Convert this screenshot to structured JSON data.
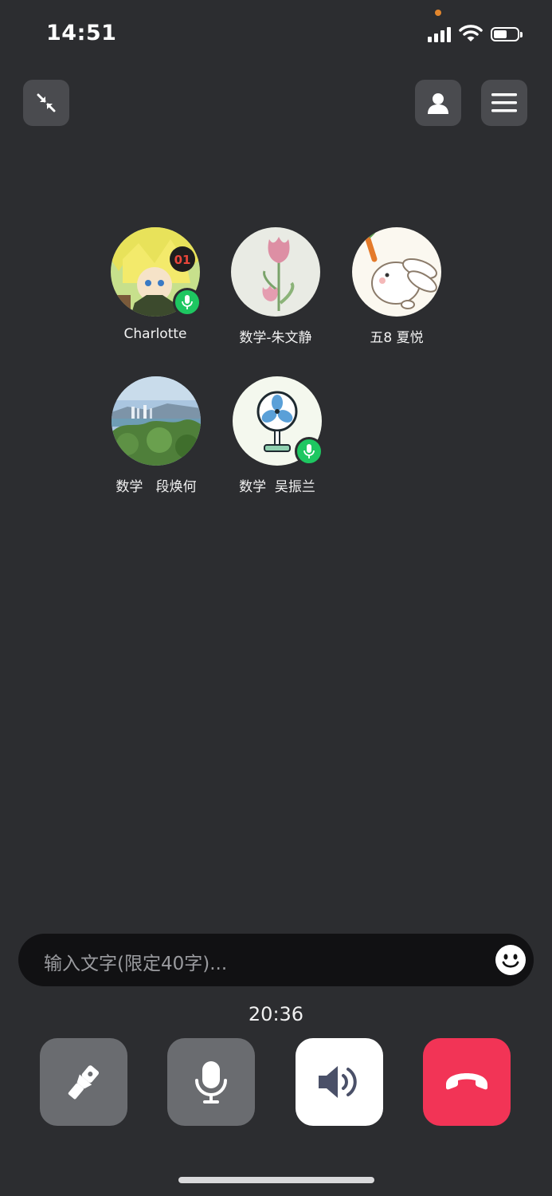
{
  "status_bar": {
    "time": "14:51"
  },
  "participants": [
    {
      "name": "Charlotte",
      "avatar": "anime-character-avatar",
      "mic_active": true
    },
    {
      "name": "数学-朱文静",
      "avatar": "tulip-flower-avatar",
      "mic_active": false
    },
    {
      "name": "五8 夏悦",
      "avatar": "rabbit-with-carrot-avatar",
      "mic_active": false
    },
    {
      "name": "数学   段焕何",
      "avatar": "coastal-city-photo-avatar",
      "mic_active": false
    },
    {
      "name": "数学  吴振兰",
      "avatar": "electric-fan-avatar",
      "mic_active": true
    }
  ],
  "chat_input": {
    "placeholder": "输入文字(限定40字)..."
  },
  "call": {
    "duration": "20:36"
  },
  "controls": [
    "flashlight-icon",
    "microphone-icon",
    "speaker-icon",
    "hang-up-icon"
  ],
  "colors": {
    "background": "#2c2d30",
    "mic_active": "#1ec761",
    "hang_up": "#f23456"
  }
}
